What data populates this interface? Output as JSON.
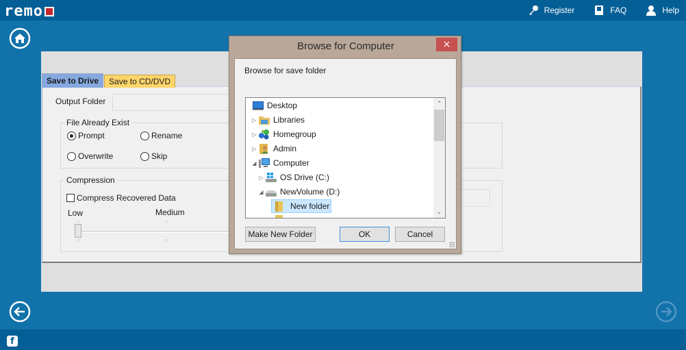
{
  "app": {
    "logo_text": "remo",
    "brand_colors": {
      "top_bar": "#045f96",
      "background": "#1272aa",
      "logo_accent": "#c1272d"
    }
  },
  "header": {
    "links": [
      {
        "label": "Register",
        "icon": "key-icon"
      },
      {
        "label": "FAQ",
        "icon": "book-icon"
      },
      {
        "label": "Help",
        "icon": "user-help-icon"
      }
    ]
  },
  "nav": {
    "home": "home-icon",
    "back": "back-arrow-icon",
    "next": "next-arrow-icon",
    "facebook": "f"
  },
  "tabs": [
    {
      "label": "Save to Drive",
      "active": true
    },
    {
      "label": "Save to CD/DVD",
      "active": false
    }
  ],
  "form": {
    "output_folder_label": "Output Folder",
    "output_folder_value": "",
    "file_exists": {
      "legend": "File Already Exist",
      "options": [
        {
          "label": "Prompt",
          "selected": true
        },
        {
          "label": "Rename",
          "selected": false
        },
        {
          "label": "Overwrite",
          "selected": false
        },
        {
          "label": "Skip",
          "selected": false
        }
      ]
    },
    "compression": {
      "legend": "Compression",
      "checkbox_label": "Compress Recovered Data",
      "checked": false,
      "slider_labels": [
        "Low",
        "Medium"
      ],
      "slider_value": "Low"
    }
  },
  "dialog": {
    "title": "Browse for Computer",
    "close_label": "×",
    "prompt": "Browse for save folder",
    "tree": [
      {
        "label": "Desktop",
        "icon": "desktop-icon",
        "level": 0,
        "expander": ""
      },
      {
        "label": "Libraries",
        "icon": "libraries-icon",
        "level": 1,
        "expander": "▷"
      },
      {
        "label": "Homegroup",
        "icon": "homegroup-icon",
        "level": 1,
        "expander": "▷"
      },
      {
        "label": "Admin",
        "icon": "user-folder-icon",
        "level": 1,
        "expander": "▷"
      },
      {
        "label": "Computer",
        "icon": "computer-icon",
        "level": 1,
        "expander": "◢"
      },
      {
        "label": "OS Drive (C:)",
        "icon": "os-drive-icon",
        "level": 2,
        "expander": "▷"
      },
      {
        "label": "NewVolume (D:)",
        "icon": "drive-icon",
        "level": 2,
        "expander": "◢"
      },
      {
        "label": "New folder",
        "icon": "folder-icon",
        "level": 3,
        "expander": "",
        "selected": true
      }
    ],
    "scroll_up": "⌃",
    "scroll_down": "⌄",
    "buttons": {
      "make_new_folder": "Make New Folder",
      "ok": "OK",
      "cancel": "Cancel"
    }
  }
}
